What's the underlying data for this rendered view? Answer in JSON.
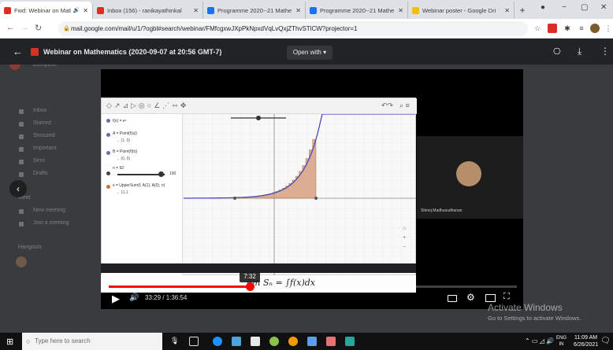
{
  "browser": {
    "tabs": [
      {
        "label": "Fwd: Webinar on Mathe",
        "color": "#d93025",
        "active": true
      },
      {
        "label": "Inbox (156) - ranikayathinkal",
        "color": "#d93025",
        "active": false
      },
      {
        "label": "Programme 2020--21 Mathe",
        "color": "#1a73e8",
        "active": false
      },
      {
        "label": "Programme 2020--21 Mathe",
        "color": "#1a73e8",
        "active": false
      },
      {
        "label": "Webinar poster - Google Dri",
        "color": "#fbbc04",
        "active": false
      }
    ],
    "new_tab_label": "+",
    "url": "mail.google.com/mail/u/1/?ogbl#search/webinar/FMfcgxwJXpPkNpxdVqLvQxjZThvSTlCW?projector=1",
    "window_controls": {
      "minimize": "−",
      "maximize": "▢",
      "close": "✕"
    }
  },
  "gmail_bg": {
    "compose_label": "Compose",
    "nav": [
      "Inbox",
      "Starred",
      "Snoozed",
      "Important",
      "Sent",
      "Drafts"
    ],
    "meet_label": "Meet",
    "meet_items": [
      "New meeting",
      "Join a meeting"
    ],
    "hangouts_label": "Hangouts"
  },
  "preview": {
    "title": "Webinar on Mathematics (2020-09-07 at 20:56 GMT-7)",
    "open_with_label": "Open with"
  },
  "video": {
    "participant_name": "Shinoj Madhusudhanan",
    "time_tooltip": "7:32",
    "time_display": "33:29 / 1:36:54",
    "progress_fraction": 0.345,
    "handwriting": "lim  Sₙ = ∫f(x)dx",
    "slider_value": "100",
    "algebra_lines": [
      "f(x) = eˣ",
      "A = Point(f(a))",
      "→ (1, 0)",
      "B = Point(f(b))",
      "→ (0, 0)",
      "n = 92",
      "s = UpperSum(f, A(1), A(0), n)",
      "→ 11.1"
    ]
  },
  "watermark": {
    "line1": "Activate Windows",
    "line2": "Go to Settings to activate Windows."
  },
  "os_taskbar": {
    "search_placeholder": "Type here to search",
    "language": "ENG",
    "region": "IN",
    "time": "11:09 AM",
    "date": "6/26/2021"
  }
}
